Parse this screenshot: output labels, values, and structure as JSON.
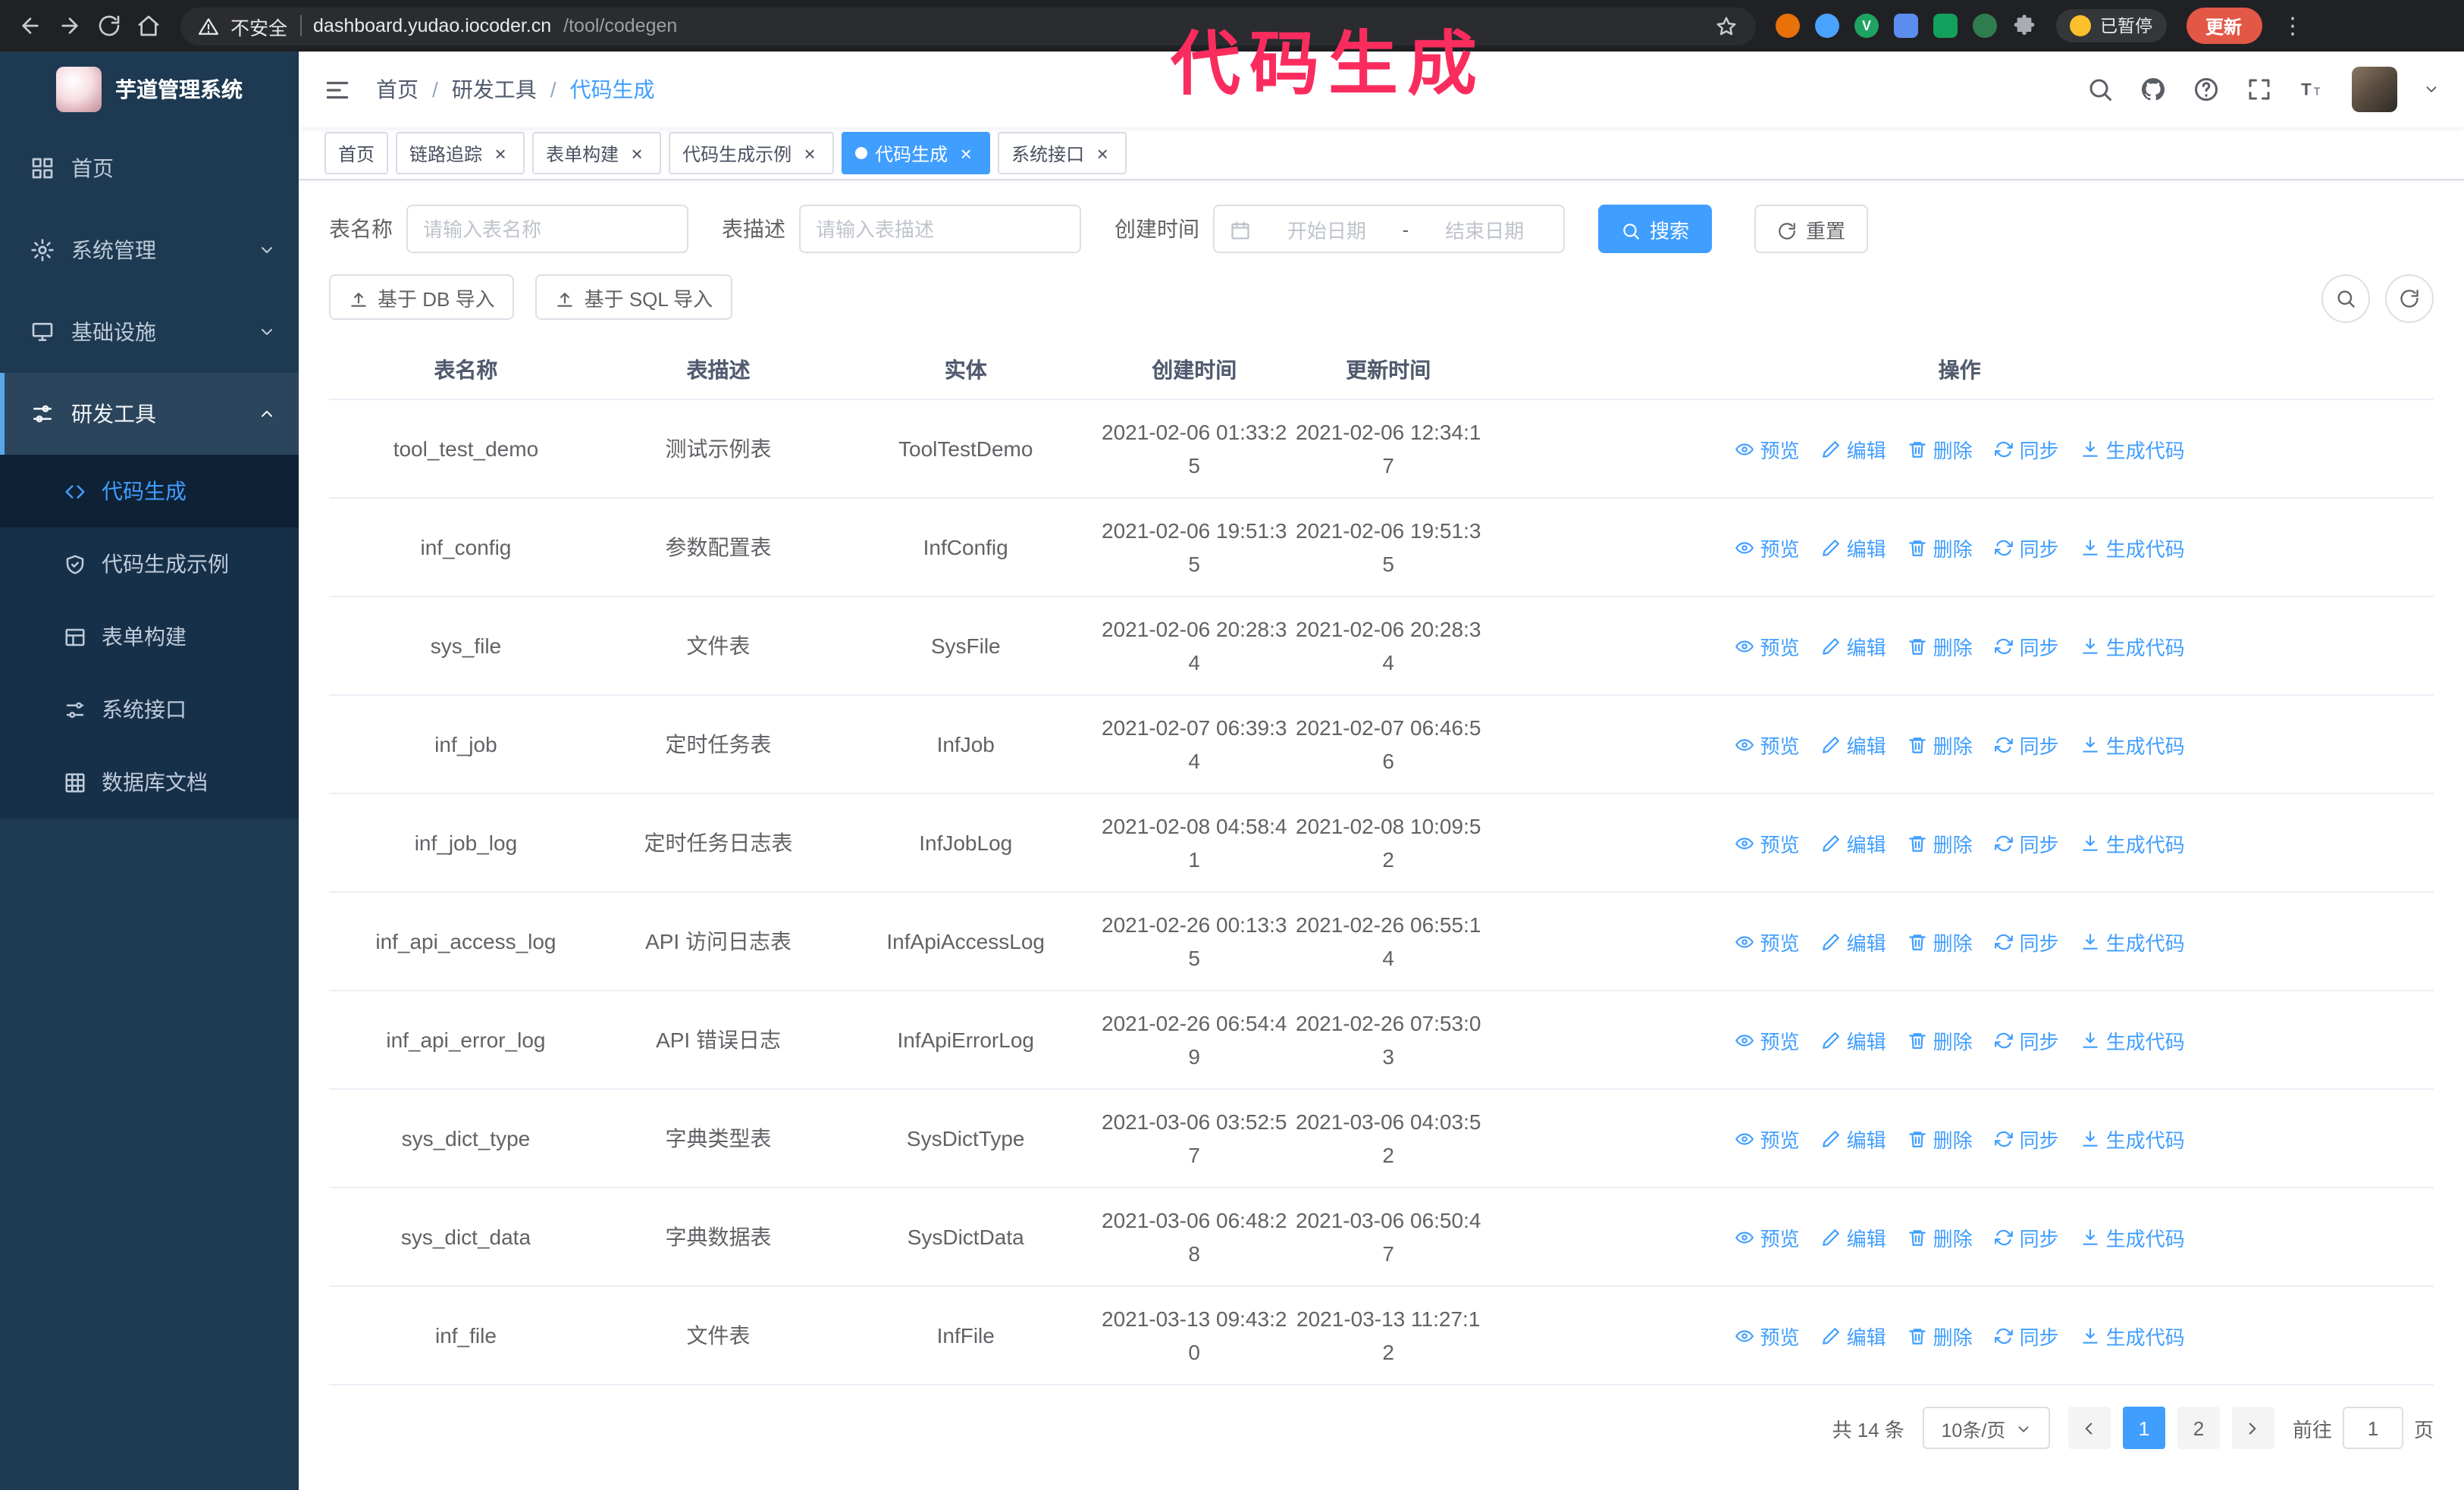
{
  "annotation": {
    "text": "代码生成",
    "color": "#fa2c5e"
  },
  "browser": {
    "nav_icons": [
      "back-icon",
      "forward-icon",
      "refresh-icon",
      "home-icon"
    ],
    "security_label": "不安全",
    "url_host": "dashboard.yudao.iocoder.cn",
    "url_path": "/tool/codegen",
    "extensions": [
      {
        "name": "fox-extension-icon",
        "color": "#e8710a",
        "shape": "circle"
      },
      {
        "name": "drop-extension-icon",
        "color": "#4aa3ff",
        "shape": "circle"
      },
      {
        "name": "v-green-extension-icon",
        "color": "#1ea362",
        "shape": "circle",
        "glyph": "V"
      },
      {
        "name": "people-extension-icon",
        "color": "#5b8def",
        "shape": "square"
      },
      {
        "name": "green-card-extension-icon",
        "color": "#12a05c",
        "shape": "square"
      },
      {
        "name": "leaf-extension-icon",
        "color": "#2f7d4f",
        "shape": "circle"
      },
      {
        "name": "puzzle-extension-icon",
        "color": "#a8adb3",
        "shape": "puzzle"
      }
    ],
    "paused_label": "已暂停",
    "update_label": "更新"
  },
  "sidebar": {
    "logo_title": "芋道管理系统",
    "items": [
      {
        "label": "首页",
        "icon": "dashboard-icon",
        "expandable": false,
        "expanded": false
      },
      {
        "label": "系统管理",
        "icon": "gear-icon",
        "expandable": true,
        "expanded": false
      },
      {
        "label": "基础设施",
        "icon": "infra-icon",
        "expandable": true,
        "expanded": false
      },
      {
        "label": "研发工具",
        "icon": "tools-icon",
        "expandable": true,
        "expanded": true
      }
    ],
    "subitems": [
      {
        "label": "代码生成",
        "icon": "code-icon",
        "active": true
      },
      {
        "label": "代码生成示例",
        "icon": "example-icon",
        "active": false
      },
      {
        "label": "表单构建",
        "icon": "form-icon",
        "active": false
      },
      {
        "label": "系统接口",
        "icon": "api-icon",
        "active": false
      },
      {
        "label": "数据库文档",
        "icon": "dbdoc-icon",
        "active": false
      }
    ]
  },
  "header": {
    "breadcrumb": [
      "首页",
      "研发工具",
      "代码生成"
    ],
    "tools": [
      "search-icon",
      "github-icon",
      "question-icon",
      "fullscreen-icon",
      "fontsize-icon"
    ]
  },
  "tags": [
    {
      "label": "首页",
      "closable": false,
      "active": false
    },
    {
      "label": "链路追踪",
      "closable": true,
      "active": false
    },
    {
      "label": "表单构建",
      "closable": true,
      "active": false
    },
    {
      "label": "代码生成示例",
      "closable": true,
      "active": false
    },
    {
      "label": "代码生成",
      "closable": true,
      "active": true
    },
    {
      "label": "系统接口",
      "closable": true,
      "active": false
    }
  ],
  "filters": {
    "table_name_label": "表名称",
    "table_name_placeholder": "请输入表名称",
    "table_desc_label": "表描述",
    "table_desc_placeholder": "请输入表描述",
    "create_time_label": "创建时间",
    "start_date_placeholder": "开始日期",
    "date_separator": "-",
    "end_date_placeholder": "结束日期",
    "search_label": "搜索",
    "reset_label": "重置"
  },
  "toolbar": {
    "import_db_label": "基于 DB 导入",
    "import_sql_label": "基于 SQL 导入"
  },
  "table": {
    "columns": [
      "表名称",
      "表描述",
      "实体",
      "创建时间",
      "更新时间",
      "操作"
    ],
    "actions": [
      "预览",
      "编辑",
      "删除",
      "同步",
      "生成代码"
    ],
    "action_keys": [
      "preview",
      "edit",
      "delete",
      "sync",
      "generate"
    ],
    "action_icons": [
      "eye-icon",
      "edit-icon",
      "delete-icon",
      "sync-icon",
      "generate-icon"
    ],
    "rows": [
      {
        "name": "tool_test_demo",
        "desc": "测试示例表",
        "entity": "ToolTestDemo",
        "created": "2021-02-06 01:33:25",
        "updated": "2021-02-06 12:34:17"
      },
      {
        "name": "inf_config",
        "desc": "参数配置表",
        "entity": "InfConfig",
        "created": "2021-02-06 19:51:35",
        "updated": "2021-02-06 19:51:35"
      },
      {
        "name": "sys_file",
        "desc": "文件表",
        "entity": "SysFile",
        "created": "2021-02-06 20:28:34",
        "updated": "2021-02-06 20:28:34"
      },
      {
        "name": "inf_job",
        "desc": "定时任务表",
        "entity": "InfJob",
        "created": "2021-02-07 06:39:34",
        "updated": "2021-02-07 06:46:56"
      },
      {
        "name": "inf_job_log",
        "desc": "定时任务日志表",
        "entity": "InfJobLog",
        "created": "2021-02-08 04:58:41",
        "updated": "2021-02-08 10:09:52"
      },
      {
        "name": "inf_api_access_log",
        "desc": "API 访问日志表",
        "entity": "InfApiAccessLog",
        "created": "2021-02-26 00:13:35",
        "updated": "2021-02-26 06:55:14"
      },
      {
        "name": "inf_api_error_log",
        "desc": "API 错误日志",
        "entity": "InfApiErrorLog",
        "created": "2021-02-26 06:54:49",
        "updated": "2021-02-26 07:53:03"
      },
      {
        "name": "sys_dict_type",
        "desc": "字典类型表",
        "entity": "SysDictType",
        "created": "2021-03-06 03:52:57",
        "updated": "2021-03-06 04:03:52"
      },
      {
        "name": "sys_dict_data",
        "desc": "字典数据表",
        "entity": "SysDictData",
        "created": "2021-03-06 06:48:28",
        "updated": "2021-03-06 06:50:47"
      },
      {
        "name": "inf_file",
        "desc": "文件表",
        "entity": "InfFile",
        "created": "2021-03-13 09:43:20",
        "updated": "2021-03-13 11:27:12"
      }
    ]
  },
  "pagination": {
    "total_label": "共 14 条",
    "page_size": "10条/页",
    "pages": [
      "1",
      "2"
    ],
    "active_page": "1",
    "goto_label": "前往",
    "goto_value": "1",
    "page_suffix": "页"
  },
  "colors": {
    "accent": "#409eff",
    "sidebar_bg": "#1e3a52",
    "annotation": "#fa2c5e",
    "update_button": "#e25746"
  }
}
